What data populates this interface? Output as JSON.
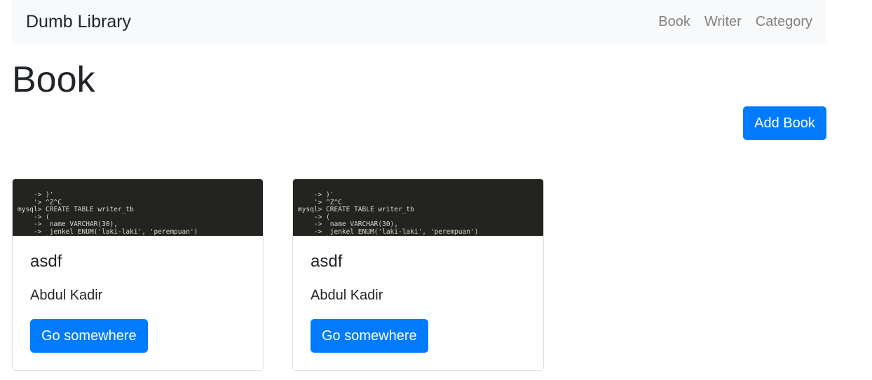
{
  "navbar": {
    "brand": "Dumb Library",
    "links": [
      "Book",
      "Writer",
      "Category"
    ]
  },
  "page": {
    "title": "Book",
    "add_button": "Add Book"
  },
  "cards": [
    {
      "title": "asdf",
      "writer": "Abdul Kadir",
      "button": "Go somewhere",
      "image_code": "    -> )'\n    '> ^Z^C\nmysql> CREATE TABLE writer_tb\n    -> (\n    ->  name VARCHAR(30),\n    ->  jenkel ENUM('laki-laki', 'perempuan')\n    -> );"
    },
    {
      "title": "asdf",
      "writer": "Abdul Kadir",
      "button": "Go somewhere",
      "image_code": "    -> )'\n    '> ^Z^C\nmysql> CREATE TABLE writer_tb\n    -> (\n    ->  name VARCHAR(30),\n    ->  jenkel ENUM('laki-laki', 'perempuan')\n    -> );"
    }
  ]
}
